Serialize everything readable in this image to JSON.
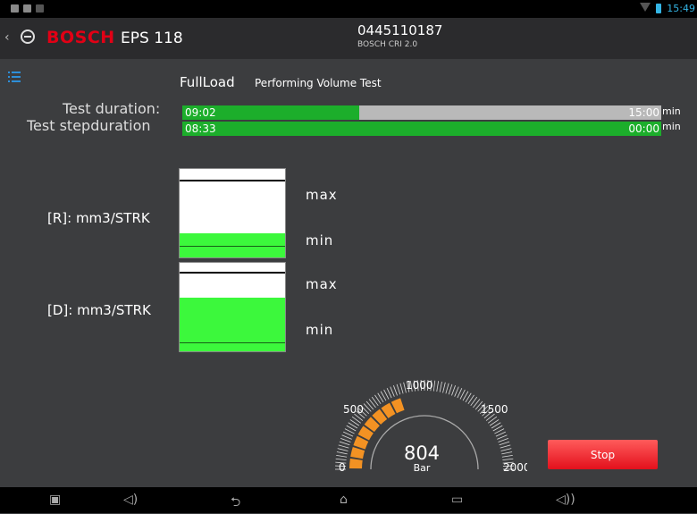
{
  "status_bar": {
    "time": "15:49"
  },
  "app_bar": {
    "brand": "BOSCH",
    "model": "EPS 118",
    "part_number": "0445110187",
    "sub": "BOSCH  CRI 2.0"
  },
  "header": {
    "title": "FullLoad",
    "subtitle": "Performing Volume Test"
  },
  "test_duration": {
    "label": "Test duration:",
    "value": "09:02",
    "total": "15:00",
    "unit": "min",
    "progress": 0.37
  },
  "step_duration": {
    "label": "Test stepduration",
    "value": "08:33",
    "total": "00:00",
    "unit": "min",
    "progress": 1.0
  },
  "gauge_r": {
    "label": "[R]: mm3/STRK",
    "max_label": "max",
    "min_label": "min",
    "level": 0.27
  },
  "gauge_d": {
    "label": "[D]: mm3/STRK",
    "max_label": "max",
    "min_label": "min",
    "level": 0.61
  },
  "pressure": {
    "value": "804",
    "unit": "Bar",
    "ticks": [
      "0",
      "500",
      "1000",
      "1500",
      "2000"
    ],
    "min": 0,
    "max": 2000,
    "reading": 804,
    "accent": "#f39223"
  },
  "actions": {
    "stop_label": "Stop"
  },
  "colors": {
    "brand": "#e20015",
    "progress": "#1cae2b",
    "level": "#3cf83c",
    "stop": "#e3101c",
    "accent": "#34b5e5"
  }
}
